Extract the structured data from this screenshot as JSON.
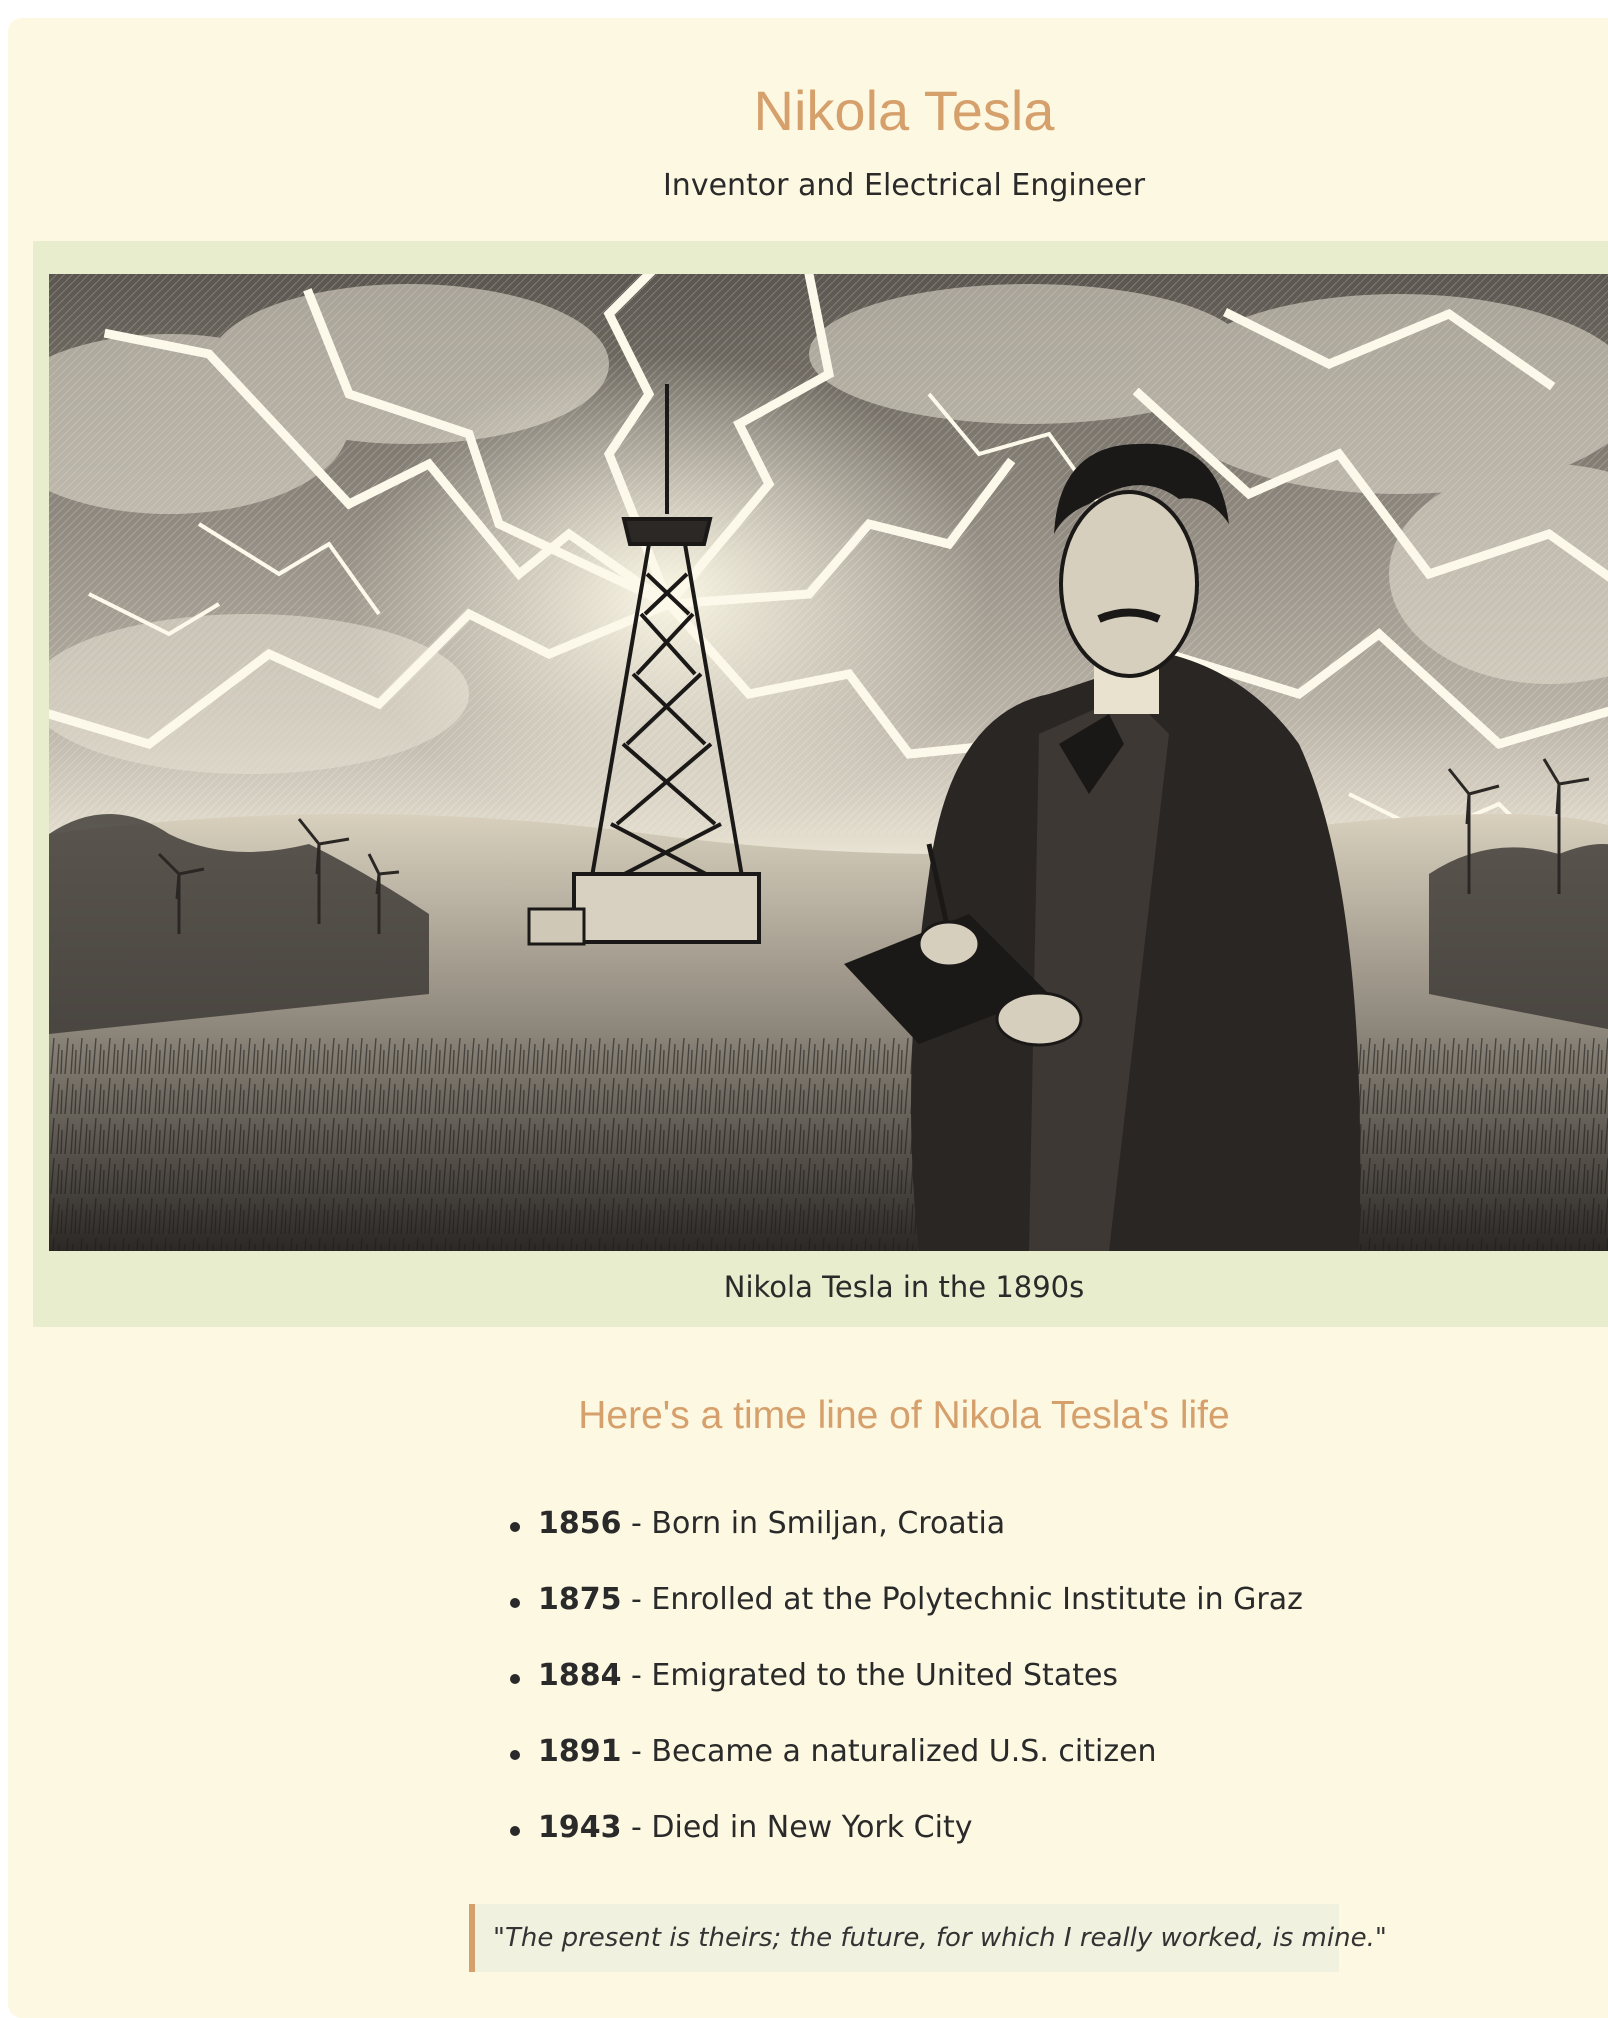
{
  "header": {
    "title": "Nikola Tesla",
    "subtitle": "Inventor and Electrical Engineer"
  },
  "figure": {
    "caption": "Nikola Tesla in the 1890s"
  },
  "timeline": {
    "heading": "Here's a time line of Nikola Tesla's life",
    "items": [
      {
        "year": "1856",
        "separator": " - ",
        "event": "Born in Smiljan, Croatia"
      },
      {
        "year": "1875",
        "separator": " - ",
        "event": "Enrolled at the Polytechnic Institute in Graz"
      },
      {
        "year": "1884",
        "separator": " - ",
        "event": "Emigrated to the United States"
      },
      {
        "year": "1891",
        "separator": " - ",
        "event": "Became a naturalized U.S. citizen"
      },
      {
        "year": "1943",
        "separator": " - ",
        "event": "Died in New York City"
      }
    ]
  },
  "quote": {
    "text": "\"The present is theirs; the future, for which I really worked, is mine.\""
  },
  "colors": {
    "page_background": "#fdf8e1",
    "figure_background": "#e8eecd",
    "accent": "#d6a06c",
    "quote_background": "#f1f1e0",
    "text": "#2a2a2a"
  }
}
